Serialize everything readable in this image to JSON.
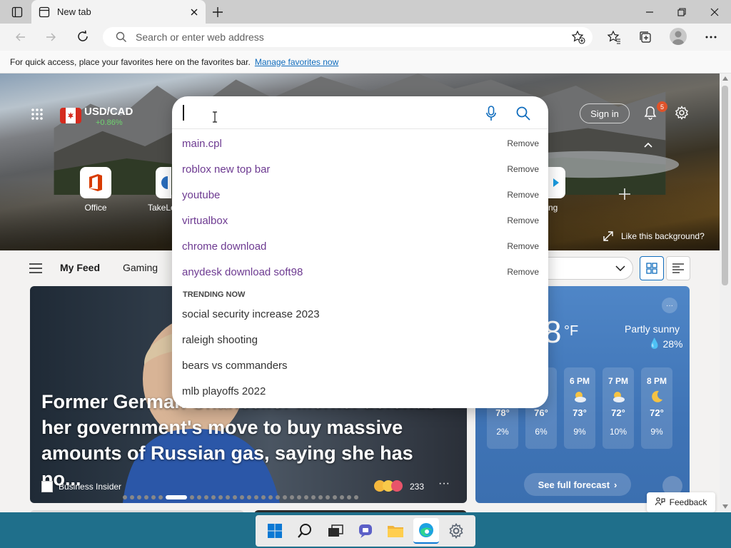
{
  "browser": {
    "tab_title": "New tab",
    "address_placeholder": "Search or enter web address"
  },
  "favorites_bar": {
    "message": "For quick access, place your favorites here on the favorites bar.",
    "link": "Manage favorites now"
  },
  "header": {
    "currency": "USD/CAD",
    "currency_change": "+0.86%",
    "sign_in": "Sign in",
    "notification_count": "5",
    "like_background": "Like this background?"
  },
  "quick_links": [
    {
      "label": "Office"
    },
    {
      "label": "TakeLe"
    },
    {
      "label": "ng"
    }
  ],
  "feed": {
    "tabs": [
      "My Feed",
      "Gaming"
    ]
  },
  "story": {
    "title": "Former German Chancellor Merkel defends her government's move to buy massive amounts of Russian gas, saying she has no...",
    "source": "Business Insider",
    "reactions": "233"
  },
  "weather": {
    "temp_digit": "8",
    "unit": "°F",
    "condition": "Partly sunny",
    "precip": "28%",
    "hours": [
      {
        "time": "M",
        "temp": "78°",
        "precip": "2%"
      },
      {
        "time": "6 PM",
        "temp": "76°",
        "precip": "6%"
      },
      {
        "time": "7 PM",
        "temp": "73°",
        "precip": "9%"
      },
      {
        "time": "8 PM",
        "temp": "72°",
        "precip": "10%"
      },
      {
        "time": "",
        "temp": "72°",
        "precip": "9%"
      }
    ],
    "forecast_button": "See full forecast"
  },
  "search_dropdown": {
    "history": [
      {
        "text": "main.cpl",
        "action": "Remove"
      },
      {
        "text": "roblox new top bar",
        "action": "Remove"
      },
      {
        "text": "youtube",
        "action": "Remove"
      },
      {
        "text": "virtualbox",
        "action": "Remove"
      },
      {
        "text": "chrome download",
        "action": "Remove"
      },
      {
        "text": "anydesk download soft98",
        "action": "Remove"
      }
    ],
    "trending_header": "TRENDING NOW",
    "trending": [
      "social security increase 2023",
      "raleigh shooting",
      "bears vs commanders",
      "mlb playoffs 2022"
    ]
  },
  "feedback": "Feedback",
  "colors": {
    "accent": "#0f6cbd",
    "history_text": "#6d3a91",
    "taskbar": "#1f6f8b"
  }
}
